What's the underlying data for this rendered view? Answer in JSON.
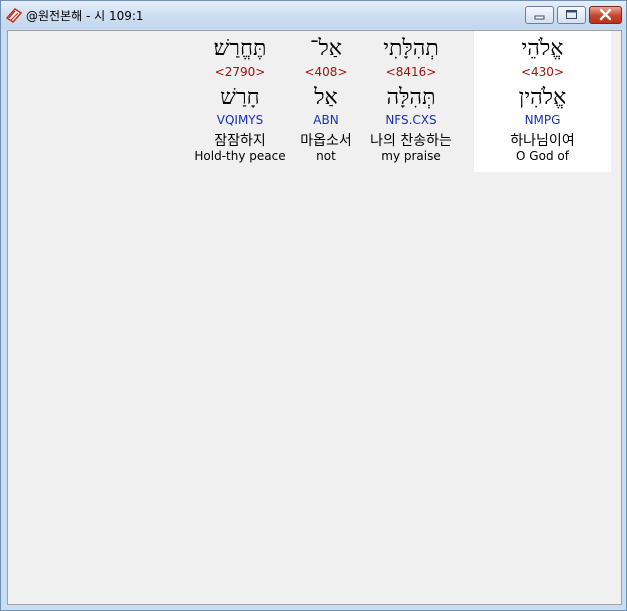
{
  "window": {
    "title": "@원전본해 - 시 109:1"
  },
  "words": [
    {
      "hebrew": "אֱלֹהֵי",
      "strong": "<430>",
      "lemma": "אֱלֹהִין",
      "morph": "NMPG",
      "korean": "하나님이여",
      "english": "O God of"
    },
    {
      "hebrew": "תְהִלָּתִי",
      "strong": "<8416>",
      "lemma": "תְּהִלָּה",
      "morph": "NFS.CXS",
      "korean": "나의 찬송하는",
      "english": "my praise"
    },
    {
      "hebrew": "אַל־",
      "strong": "<408>",
      "lemma": "אַל",
      "morph": "ABN",
      "korean": "마옵소서",
      "english": "not"
    },
    {
      "hebrew": "תֶּחֱרַשׁ׃",
      "strong": "<2790>",
      "lemma": "חָרַשׁ",
      "morph": "VQIMYS",
      "korean": "잠잠하지",
      "english": "Hold-thy peace"
    }
  ],
  "colors": {
    "strong_number": "#a01010",
    "morphology": "#1a2fb0",
    "highlight_background": "#ffffff",
    "content_background": "#f0f0f0"
  },
  "icons": {
    "app": "bible-app-icon",
    "minimize": "minimize-icon",
    "maximize": "maximize-icon",
    "close": "close-icon"
  }
}
